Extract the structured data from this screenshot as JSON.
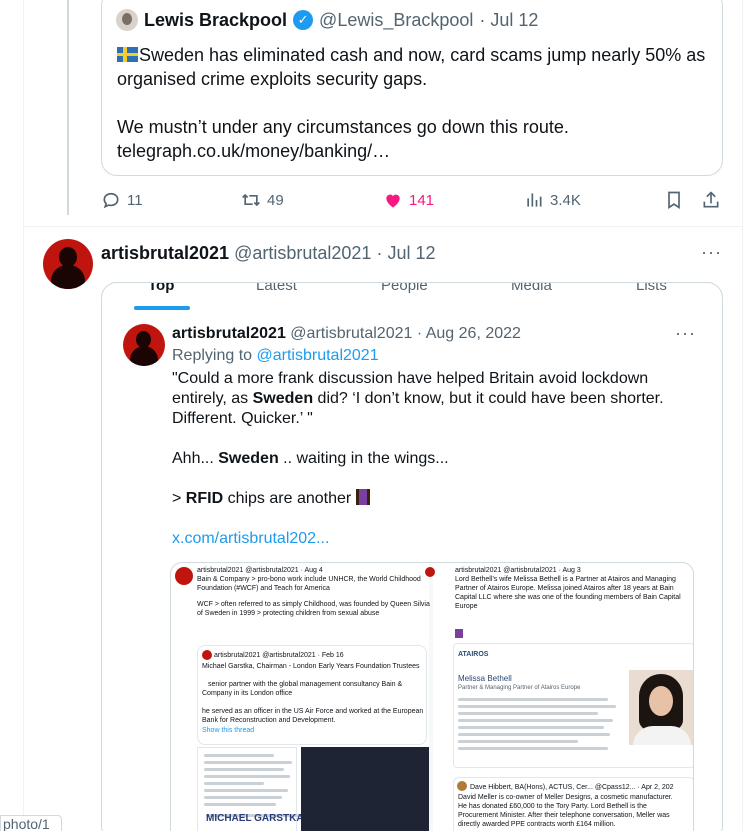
{
  "quoted_tweet": {
    "name": "Lewis Brackpool",
    "handle": "@Lewis_Brackpool",
    "date": "· Jul 12",
    "text": "Sweden has eliminated cash and now, card scams jump nearly 50% as organised crime exploits security gaps.\n\nWe mustn’t under any circumstances go down this route.\ntelegraph.co.uk/money/banking/…"
  },
  "actions": {
    "replies": "11",
    "reposts": "49",
    "likes": "141",
    "views": "3.4K"
  },
  "main_tweet": {
    "name": "artisbrutal2021",
    "handle": "@artisbrutal2021",
    "date": "· Jul 12",
    "more": "···"
  },
  "media": {
    "tabs": [
      "Top",
      "Latest",
      "People",
      "Media",
      "Lists"
    ],
    "inner_tweet": {
      "name": "artisbrutal2021",
      "handle": "@artisbrutal2021",
      "date": "· Aug 26, 2022",
      "replying_prefix": "Replying to ",
      "replying_handle": "@artisbrutal2021",
      "para1": "\"Could a more frank discussion have helped Britain avoid lockdown entirely, as ",
      "para1_bold": "Sweden",
      "para1_end": " did? ‘I don’t know, but it could have been shorter. Different. Quicker.’ \"",
      "para2_start": "Ahh... ",
      "para2_bold": "Sweden",
      "para2_end": " .. waiting in the wings...",
      "para3_start": "> ",
      "para3_bold": "RFID",
      "para3_end": " chips are another ",
      "link": "x.com/artisbrutal202..."
    },
    "screenshot": {
      "left_head": "artisbrutal2021 @artisbrutal2021 · Aug 4",
      "left_l1": "Bain & Company > pro-bono work include UNHCR, the World Childhood",
      "left_l2": "Foundation (#WCF) and Teach for America",
      "left_l3": "WCF > often referred to as simply Childhood, was founded by Queen Silvia",
      "left_l4": "of Sweden in 1999 > protecting children from sexual abuse",
      "nested_head": "artisbrutal2021 @artisbrutal2021 · Feb 16",
      "nested_l1": "Michael Garstka, Chairman - London Early Years Foundation Trustees",
      "nested_l2": "senior partner with the global management consultancy Bain &",
      "nested_l3": "Company in its London office",
      "nested_l4": "he served as an officer in the US Air Force and worked at the European",
      "nested_l5": "Bank for Reconstruction and Development.",
      "nested_l6": "Show this thread",
      "garstka": "MICHAEL GARSTKA",
      "right_head": "artisbrutal2021 @artisbrutal2021 · Aug 3",
      "right_l1": "Lord Bethell’s wife Melissa Bethell is a Partner at Atairos and Managing",
      "right_l2": "Partner of Atairos Europe. Melissa joined Atairos after 18 years at Bain",
      "right_l3": "Capital LLC where she was one of the founding members of Bain Capital",
      "right_l4": "Europe",
      "atairos": "ATAIROS",
      "melissa": "Melissa Bethell",
      "melissa_sub": "Partner & Managing Partner of Atairos Europe",
      "dave_head": "Dave Hibbert, BA(Hons), ACTUS, Cer... @Cpass12... · Apr 2, 202",
      "dave_l1": "David Meller is co-owner of Meller Designs, a cosmetic manufacturer.",
      "dave_l2": "He has donated £60,000 to the Tory Party. Lord Bethell is the",
      "dave_l3": "Procurement Minister. After their telephone conversation, Meller was",
      "dave_l4": "directly awarded PPE contracts worth £164 million."
    }
  },
  "corner_label": "photo/1",
  "colors": {
    "accent": "#1d9bf0",
    "like": "#f91880",
    "muted": "#536471"
  }
}
